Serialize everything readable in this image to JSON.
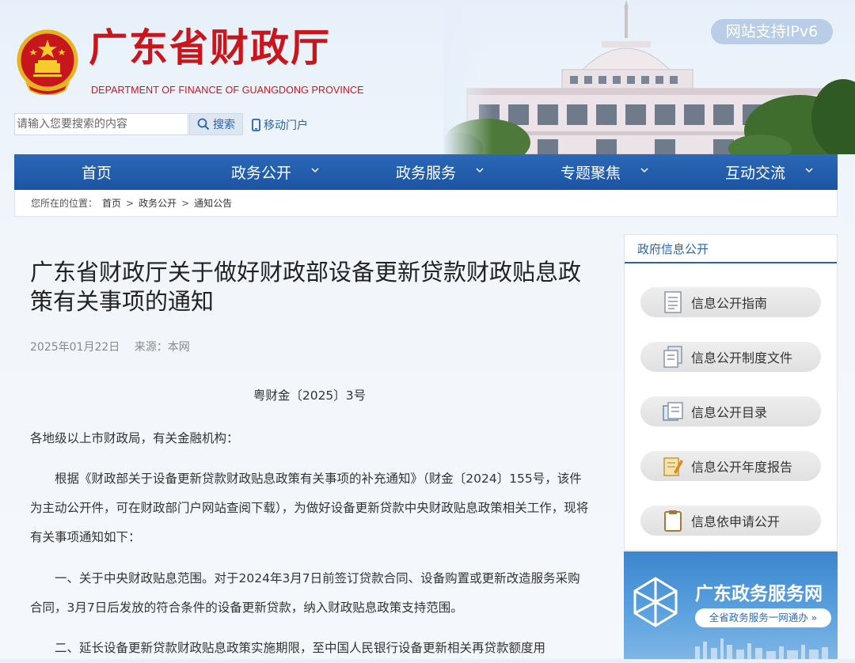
{
  "header": {
    "title": "广东省财政厅",
    "subtitle": "DEPARTMENT OF FINANCE OF GUANGDONG PROVINCE",
    "ipv6_badge": "网站支持IPv6",
    "search_placeholder": "请输入您要搜索的内容",
    "search_button": "搜索",
    "mobile_link": "移动门户"
  },
  "nav": {
    "items": [
      {
        "label": "首页",
        "has_dropdown": false
      },
      {
        "label": "政务公开",
        "has_dropdown": true
      },
      {
        "label": "政务服务",
        "has_dropdown": true
      },
      {
        "label": "专题聚焦",
        "has_dropdown": true
      },
      {
        "label": "互动交流",
        "has_dropdown": true
      }
    ]
  },
  "breadcrumb": {
    "prefix": "您所在的位置：",
    "items": [
      "首页",
      "政务公开",
      "通知公告"
    ],
    "separator": ">"
  },
  "article": {
    "title": "广东省财政厅关于做好财政部设备更新贷款财政贴息政策有关事项的通知",
    "date": "2025年01月22日",
    "source": "来源：本网",
    "doc_number": "粤财金〔2025〕3号",
    "addressee": "各地级以上市财政局，有关金融机构：",
    "paragraphs": [
      "根据《财政部关于设备更新贷款财政贴息政策有关事项的补充通知》（财金〔2024〕155号，该件为主动公开件，可在财政部门户网站查阅下载），为做好设备更新贷款中央财政贴息政策相关工作，现将有关事项通知如下：",
      "一、关于中央财政贴息范围。对于2024年3月7日前签订贷款合同、设备购置或更新改造服务采购合同，3月7日后发放的符合条件的设备更新贷款，纳入财政贴息政策支持范围。",
      "二、延长设备更新贷款财政贴息政策实施期限，至中国人民银行设备更新相关再贷款额度用"
    ]
  },
  "sidebar": {
    "header": "政府信息公开",
    "items": [
      {
        "label": "信息公开指南",
        "icon": "document-icon"
      },
      {
        "label": "信息公开制度文件",
        "icon": "files-icon"
      },
      {
        "label": "信息公开目录",
        "icon": "folder-icon"
      },
      {
        "label": "信息公开年度报告",
        "icon": "report-pen-icon"
      },
      {
        "label": "信息依申请公开",
        "icon": "clipboard-icon"
      }
    ]
  },
  "banner": {
    "title": "广东政务服务网",
    "slogan": "全省政务服务一网通办 »"
  },
  "colors": {
    "brand_red": "#c8161d",
    "nav_blue": "#1f58a8",
    "link_blue": "#2a63ad",
    "banner_blue": "#4a93d8"
  }
}
